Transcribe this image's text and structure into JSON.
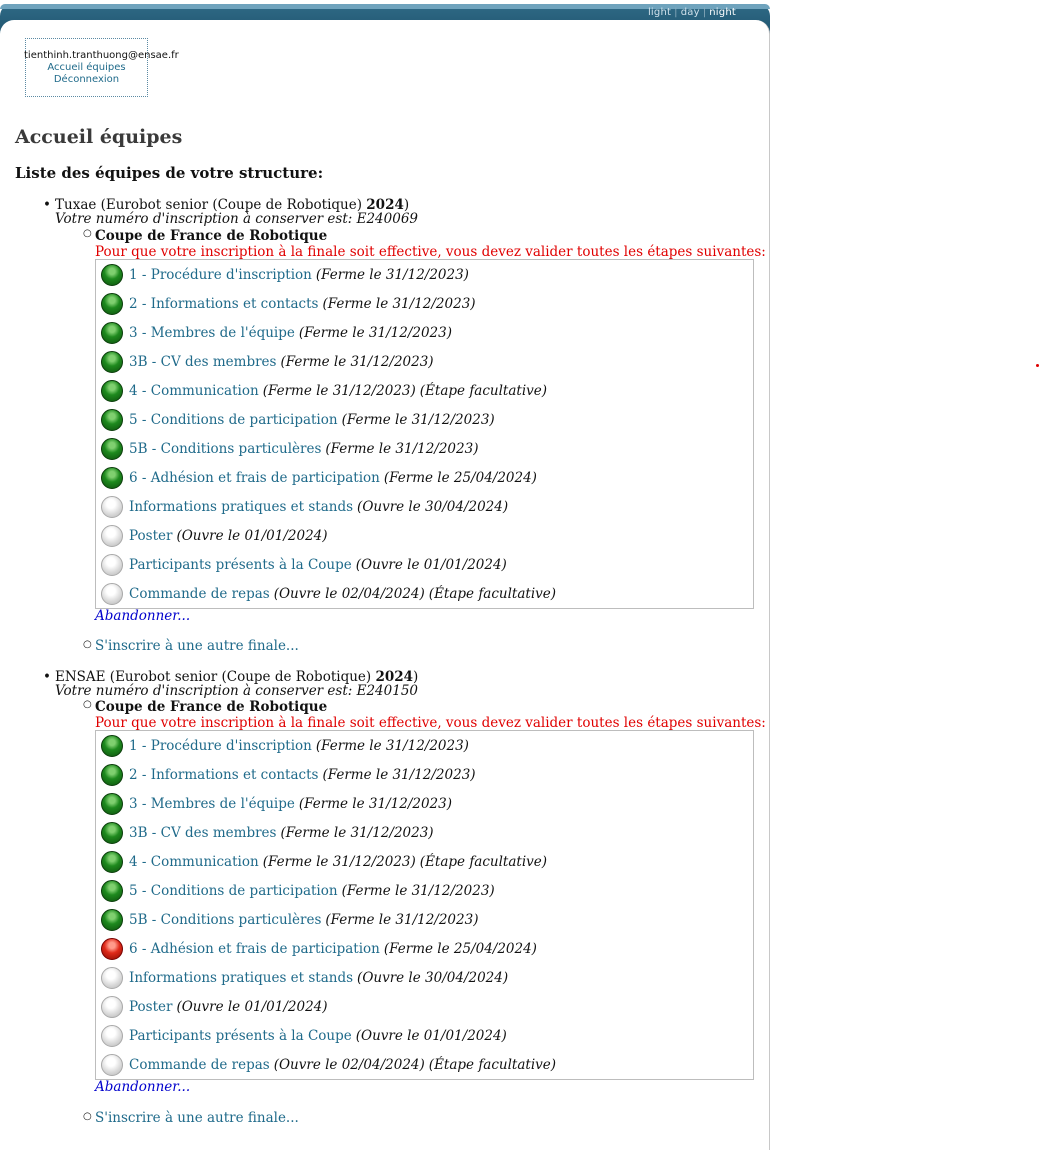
{
  "theme": {
    "options": [
      "light",
      "day",
      "night"
    ],
    "active": "night"
  },
  "user": {
    "email": "tienthinh.tranthuong@ensae.fr",
    "home_link": "Accueil équipes",
    "logout_link": "Déconnexion"
  },
  "page_title": "Accueil équipes",
  "section_title": "Liste des équipes de votre structure:",
  "teams": [
    {
      "name_prefix": "Tuxae (Eurobot senior (Coupe de Robotique) ",
      "year": "2024",
      "name_suffix": ")",
      "regno": "Votre numéro d'inscription à conserver est: E240069",
      "competition": "Coupe de France de Robotique",
      "warning": "Pour que votre inscription à la finale soit effective, vous devez valider toutes les étapes suivantes:",
      "steps": [
        {
          "status": "green",
          "name": "1 - Procédure d'inscription",
          "note": "(Ferme le 31/12/2023)",
          "optional": ""
        },
        {
          "status": "green",
          "name": "2 - Informations et contacts",
          "note": "(Ferme le 31/12/2023)",
          "optional": ""
        },
        {
          "status": "green",
          "name": "3 - Membres de l'équipe",
          "note": "(Ferme le 31/12/2023)",
          "optional": ""
        },
        {
          "status": "green",
          "name": "3B - CV des membres",
          "note": "(Ferme le 31/12/2023)",
          "optional": ""
        },
        {
          "status": "green",
          "name": "4 - Communication",
          "note": "(Ferme le 31/12/2023)",
          "optional": "(Étape facultative)"
        },
        {
          "status": "green",
          "name": "5 - Conditions de participation",
          "note": "(Ferme le 31/12/2023)",
          "optional": ""
        },
        {
          "status": "green",
          "name": "5B - Conditions particulères",
          "note": "(Ferme le 31/12/2023)",
          "optional": ""
        },
        {
          "status": "green",
          "name": "6 - Adhésion et frais de participation",
          "note": "(Ferme le 25/04/2024)",
          "optional": ""
        },
        {
          "status": "grey",
          "name": "Informations pratiques et stands",
          "note": "(Ouvre le 30/04/2024)",
          "optional": ""
        },
        {
          "status": "grey",
          "name": "Poster",
          "note": "(Ouvre le 01/01/2024)",
          "optional": ""
        },
        {
          "status": "grey",
          "name": "Participants présents à la Coupe",
          "note": "(Ouvre le 01/01/2024)",
          "optional": ""
        },
        {
          "status": "grey",
          "name": "Commande de repas",
          "note": "(Ouvre le 02/04/2024)",
          "optional": "(Étape facultative)"
        }
      ],
      "abandon": "Abandonner...",
      "other_finale": "S'inscrire à une autre finale..."
    },
    {
      "name_prefix": "ENSAE (Eurobot senior (Coupe de Robotique) ",
      "year": "2024",
      "name_suffix": ")",
      "regno": "Votre numéro d'inscription à conserver est: E240150",
      "competition": "Coupe de France de Robotique",
      "warning": "Pour que votre inscription à la finale soit effective, vous devez valider toutes les étapes suivantes:",
      "steps": [
        {
          "status": "green",
          "name": "1 - Procédure d'inscription",
          "note": "(Ferme le 31/12/2023)",
          "optional": ""
        },
        {
          "status": "green",
          "name": "2 - Informations et contacts",
          "note": "(Ferme le 31/12/2023)",
          "optional": ""
        },
        {
          "status": "green",
          "name": "3 - Membres de l'équipe",
          "note": "(Ferme le 31/12/2023)",
          "optional": ""
        },
        {
          "status": "green",
          "name": "3B - CV des membres",
          "note": "(Ferme le 31/12/2023)",
          "optional": ""
        },
        {
          "status": "green",
          "name": "4 - Communication",
          "note": "(Ferme le 31/12/2023)",
          "optional": "(Étape facultative)"
        },
        {
          "status": "green",
          "name": "5 - Conditions de participation",
          "note": "(Ferme le 31/12/2023)",
          "optional": ""
        },
        {
          "status": "green",
          "name": "5B - Conditions particulères",
          "note": "(Ferme le 31/12/2023)",
          "optional": ""
        },
        {
          "status": "red",
          "name": "6 - Adhésion et frais de participation",
          "note": "(Ferme le 25/04/2024)",
          "optional": ""
        },
        {
          "status": "grey",
          "name": "Informations pratiques et stands",
          "note": "(Ouvre le 30/04/2024)",
          "optional": ""
        },
        {
          "status": "grey",
          "name": "Poster",
          "note": "(Ouvre le 01/01/2024)",
          "optional": ""
        },
        {
          "status": "grey",
          "name": "Participants présents à la Coupe",
          "note": "(Ouvre le 01/01/2024)",
          "optional": ""
        },
        {
          "status": "grey",
          "name": "Commande de repas",
          "note": "(Ouvre le 02/04/2024)",
          "optional": "(Étape facultative)"
        }
      ],
      "abandon": "Abandonner...",
      "other_finale": "S'inscrire à une autre finale..."
    }
  ]
}
